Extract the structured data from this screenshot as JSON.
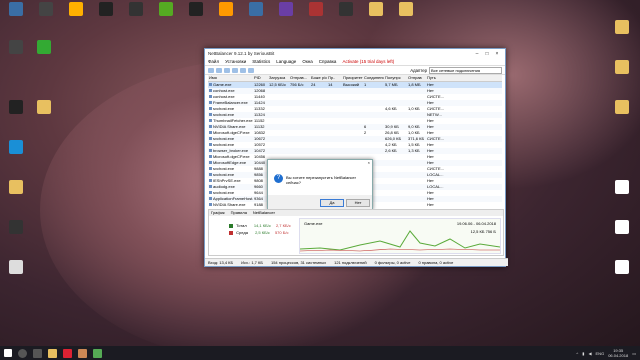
{
  "desktop": {
    "icons": [
      {
        "label": "",
        "color": "#3a6ea5"
      },
      {
        "label": "",
        "color": "#444"
      },
      {
        "label": "",
        "color": "#ffb000"
      },
      {
        "label": "",
        "color": "#222"
      },
      {
        "label": "",
        "color": "#333"
      },
      {
        "label": "",
        "color": "#5a2"
      },
      {
        "label": "",
        "color": "#222"
      },
      {
        "label": "",
        "color": "#f90"
      },
      {
        "label": "",
        "color": "#3a6ea5"
      },
      {
        "label": "",
        "color": "#6a3ea5"
      },
      {
        "label": "",
        "color": "#a33"
      },
      {
        "label": "",
        "color": "#333"
      },
      {
        "label": "",
        "color": "#e8c060"
      },
      {
        "label": "",
        "color": "#e8c060"
      },
      {
        "label": "",
        "color": "#444"
      },
      {
        "label": "",
        "color": "#3a3"
      },
      {
        "label": "",
        "color": "#222"
      },
      {
        "label": "",
        "color": "#e8c060"
      },
      {
        "label": "",
        "color": "#1a8fd6"
      },
      {
        "label": "",
        "color": "#e8c060"
      },
      {
        "label": "",
        "color": "#333"
      },
      {
        "label": "",
        "color": "#ddd"
      }
    ],
    "right_icons": [
      {
        "label": "",
        "color": "#e8c060"
      },
      {
        "label": "",
        "color": "#e8c060"
      },
      {
        "label": "",
        "color": "#e8c060"
      },
      {
        "label": "",
        "color": "#fff"
      },
      {
        "label": "",
        "color": "#fff"
      },
      {
        "label": "",
        "color": "#fff"
      }
    ]
  },
  "window": {
    "title": "NetBalancer 9.12.1 by SeriousBit",
    "menu": [
      "Файл",
      "Установки",
      "Statistics",
      "Language",
      "Окна",
      "Справка"
    ],
    "activate": "Activate (15 trial days left)",
    "adapter_label": "Адаптер",
    "adapter_value": "Все сетевые подключения",
    "columns": [
      "Имя",
      "PID",
      "Загрузка",
      "Отправ...",
      "Боже р/с",
      "Пр..",
      "Приоритет",
      "Соединение",
      "Полупрс",
      "Отправ",
      "Путь"
    ],
    "rows": [
      [
        "Game.exe",
        "12260",
        "12,5 КБ/с",
        "756 Б/с",
        "24",
        "14",
        "Высокий",
        "1",
        "5,7 МБ",
        "1,8 МБ",
        "Нет"
      ],
      [
        "conhost.exe",
        "12068",
        "",
        "",
        "",
        "",
        "",
        "",
        "",
        "",
        "Нет"
      ],
      [
        "conhost.exe",
        "11440",
        "",
        "",
        "",
        "",
        "",
        "",
        "",
        "",
        "СИСТЕ..."
      ],
      [
        "FrameBalancer.exe",
        "11424",
        "",
        "",
        "",
        "",
        "",
        "",
        "",
        "",
        "Нет"
      ],
      [
        "svchost.exe",
        "11332",
        "",
        "",
        "",
        "",
        "",
        "",
        "4,6 КБ",
        "1,0 КБ",
        "СИСТЕ..."
      ],
      [
        "svchost.exe",
        "11324",
        "",
        "",
        "",
        "",
        "",
        "",
        "",
        "",
        "NETW..."
      ],
      [
        "ThumbnailFetcher.exe",
        "11152",
        "",
        "",
        "",
        "",
        "",
        "",
        "",
        "",
        "Нет"
      ],
      [
        "NVIDIA Share.exe",
        "11132",
        "",
        "",
        "",
        "",
        "",
        "6",
        "30,9 КБ",
        "9,0 КБ",
        "Нет"
      ],
      [
        "Microsoft.dgeCP.exe",
        "10832",
        "",
        "",
        "",
        "",
        "",
        "2",
        "26,8 КБ",
        "1,0 КБ",
        "Нет"
      ],
      [
        "svchost.exe",
        "10672",
        "",
        "",
        "",
        "",
        "",
        "",
        "626,0 КБ",
        "371,6 КБ",
        "СИСТЕ..."
      ],
      [
        "svchost.exe",
        "10572",
        "",
        "",
        "",
        "",
        "",
        "",
        "4,2 КБ",
        "1,5 КБ",
        "Нет"
      ],
      [
        "browser_broker.exe",
        "10472",
        "",
        "",
        "",
        "",
        "",
        "",
        "2,6 КБ",
        "1,3 КБ",
        "Нет"
      ],
      [
        "Microsoft.dgeCP.exe",
        "10456",
        "",
        "",
        "",
        "",
        "",
        "",
        "",
        "",
        "Нет"
      ],
      [
        "MicrosoftEdge.exe",
        "10440",
        "",
        "",
        "",
        "",
        "",
        "",
        "",
        "",
        "Нет"
      ],
      [
        "svchost.exe",
        "9888",
        "",
        "",
        "",
        "",
        "",
        "",
        "",
        "",
        "СИСТЕ..."
      ],
      [
        "svchost.exe",
        "9856",
        "",
        "",
        "",
        "",
        "",
        "",
        "",
        "",
        "LOCAL..."
      ],
      [
        "IEShPrvSE.exe",
        "9808",
        "",
        "",
        "",
        "",
        "",
        "",
        "",
        "",
        "Нет"
      ],
      [
        "audiodg.exe",
        "9660",
        "",
        "",
        "",
        "",
        "",
        "",
        "",
        "",
        "LOCAL..."
      ],
      [
        "svchost.exe",
        "9644",
        "",
        "",
        "",
        "",
        "",
        "",
        "",
        "",
        "Нет"
      ],
      [
        "ApplicationFrameHost.exe",
        "9364",
        "",
        "",
        "",
        "",
        "",
        "",
        "",
        "",
        "Нет"
      ],
      [
        "NVIDIA Share.exe",
        "9188",
        "",
        "",
        "",
        "",
        "",
        "",
        "",
        "",
        "Нет"
      ]
    ],
    "graph": {
      "tabs": [
        "График",
        "Правила",
        "NetBalancer"
      ],
      "legend": [
        {
          "label": "Тотал",
          "in": "14,1 КБ/с",
          "out": "2,7 КБ/с"
        },
        {
          "label": "Среда",
          "in": "2,5 КБ/с",
          "out": "570 Б/с"
        }
      ],
      "date_range": "19.06.06 - 06.04.2018",
      "selected_process": "Game.exe",
      "current_in": "12,5 КБ",
      "current_out": "756 Б"
    },
    "status": [
      "Вход: 13,4 КБ",
      "Исх.: 1,7 КБ",
      "154 процессов, 31 системных",
      "121 подключений",
      "0 фильтры, 0 active",
      "0 правила, 0 active"
    ]
  },
  "dialog": {
    "message": "Вы хотите перезапустить NetBalancer сейчас?",
    "yes": "Да",
    "no": "Нет"
  },
  "taskbar": {
    "lang": "ENG",
    "time": "19:35",
    "date": "06.04.2018"
  }
}
